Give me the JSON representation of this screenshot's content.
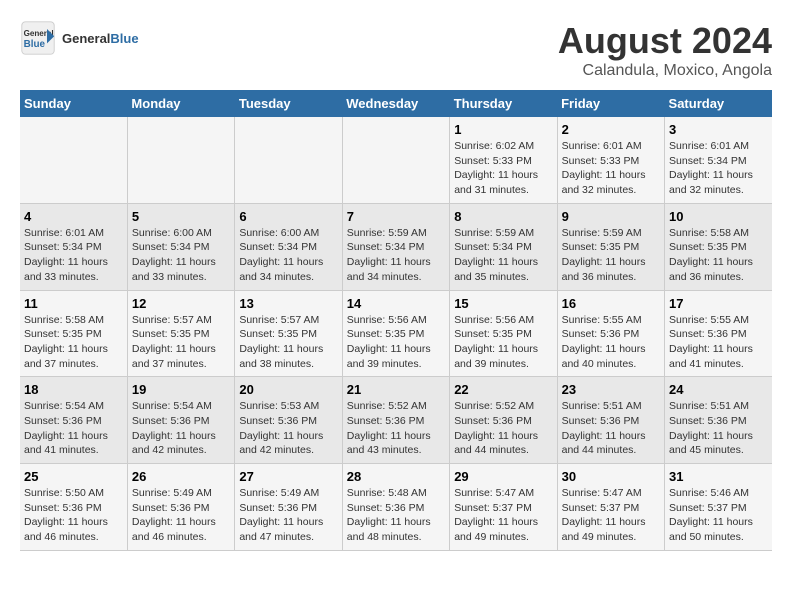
{
  "logo": {
    "name_part1": "General",
    "name_part2": "Blue"
  },
  "title": "August 2024",
  "subtitle": "Calandula, Moxico, Angola",
  "days_of_week": [
    "Sunday",
    "Monday",
    "Tuesday",
    "Wednesday",
    "Thursday",
    "Friday",
    "Saturday"
  ],
  "weeks": [
    [
      {
        "day": "",
        "info": ""
      },
      {
        "day": "",
        "info": ""
      },
      {
        "day": "",
        "info": ""
      },
      {
        "day": "",
        "info": ""
      },
      {
        "day": "1",
        "info": "Sunrise: 6:02 AM\nSunset: 5:33 PM\nDaylight: 11 hours and 31 minutes."
      },
      {
        "day": "2",
        "info": "Sunrise: 6:01 AM\nSunset: 5:33 PM\nDaylight: 11 hours and 32 minutes."
      },
      {
        "day": "3",
        "info": "Sunrise: 6:01 AM\nSunset: 5:34 PM\nDaylight: 11 hours and 32 minutes."
      }
    ],
    [
      {
        "day": "4",
        "info": "Sunrise: 6:01 AM\nSunset: 5:34 PM\nDaylight: 11 hours and 33 minutes."
      },
      {
        "day": "5",
        "info": "Sunrise: 6:00 AM\nSunset: 5:34 PM\nDaylight: 11 hours and 33 minutes."
      },
      {
        "day": "6",
        "info": "Sunrise: 6:00 AM\nSunset: 5:34 PM\nDaylight: 11 hours and 34 minutes."
      },
      {
        "day": "7",
        "info": "Sunrise: 5:59 AM\nSunset: 5:34 PM\nDaylight: 11 hours and 34 minutes."
      },
      {
        "day": "8",
        "info": "Sunrise: 5:59 AM\nSunset: 5:34 PM\nDaylight: 11 hours and 35 minutes."
      },
      {
        "day": "9",
        "info": "Sunrise: 5:59 AM\nSunset: 5:35 PM\nDaylight: 11 hours and 36 minutes."
      },
      {
        "day": "10",
        "info": "Sunrise: 5:58 AM\nSunset: 5:35 PM\nDaylight: 11 hours and 36 minutes."
      }
    ],
    [
      {
        "day": "11",
        "info": "Sunrise: 5:58 AM\nSunset: 5:35 PM\nDaylight: 11 hours and 37 minutes."
      },
      {
        "day": "12",
        "info": "Sunrise: 5:57 AM\nSunset: 5:35 PM\nDaylight: 11 hours and 37 minutes."
      },
      {
        "day": "13",
        "info": "Sunrise: 5:57 AM\nSunset: 5:35 PM\nDaylight: 11 hours and 38 minutes."
      },
      {
        "day": "14",
        "info": "Sunrise: 5:56 AM\nSunset: 5:35 PM\nDaylight: 11 hours and 39 minutes."
      },
      {
        "day": "15",
        "info": "Sunrise: 5:56 AM\nSunset: 5:35 PM\nDaylight: 11 hours and 39 minutes."
      },
      {
        "day": "16",
        "info": "Sunrise: 5:55 AM\nSunset: 5:36 PM\nDaylight: 11 hours and 40 minutes."
      },
      {
        "day": "17",
        "info": "Sunrise: 5:55 AM\nSunset: 5:36 PM\nDaylight: 11 hours and 41 minutes."
      }
    ],
    [
      {
        "day": "18",
        "info": "Sunrise: 5:54 AM\nSunset: 5:36 PM\nDaylight: 11 hours and 41 minutes."
      },
      {
        "day": "19",
        "info": "Sunrise: 5:54 AM\nSunset: 5:36 PM\nDaylight: 11 hours and 42 minutes."
      },
      {
        "day": "20",
        "info": "Sunrise: 5:53 AM\nSunset: 5:36 PM\nDaylight: 11 hours and 42 minutes."
      },
      {
        "day": "21",
        "info": "Sunrise: 5:52 AM\nSunset: 5:36 PM\nDaylight: 11 hours and 43 minutes."
      },
      {
        "day": "22",
        "info": "Sunrise: 5:52 AM\nSunset: 5:36 PM\nDaylight: 11 hours and 44 minutes."
      },
      {
        "day": "23",
        "info": "Sunrise: 5:51 AM\nSunset: 5:36 PM\nDaylight: 11 hours and 44 minutes."
      },
      {
        "day": "24",
        "info": "Sunrise: 5:51 AM\nSunset: 5:36 PM\nDaylight: 11 hours and 45 minutes."
      }
    ],
    [
      {
        "day": "25",
        "info": "Sunrise: 5:50 AM\nSunset: 5:36 PM\nDaylight: 11 hours and 46 minutes."
      },
      {
        "day": "26",
        "info": "Sunrise: 5:49 AM\nSunset: 5:36 PM\nDaylight: 11 hours and 46 minutes."
      },
      {
        "day": "27",
        "info": "Sunrise: 5:49 AM\nSunset: 5:36 PM\nDaylight: 11 hours and 47 minutes."
      },
      {
        "day": "28",
        "info": "Sunrise: 5:48 AM\nSunset: 5:36 PM\nDaylight: 11 hours and 48 minutes."
      },
      {
        "day": "29",
        "info": "Sunrise: 5:47 AM\nSunset: 5:37 PM\nDaylight: 11 hours and 49 minutes."
      },
      {
        "day": "30",
        "info": "Sunrise: 5:47 AM\nSunset: 5:37 PM\nDaylight: 11 hours and 49 minutes."
      },
      {
        "day": "31",
        "info": "Sunrise: 5:46 AM\nSunset: 5:37 PM\nDaylight: 11 hours and 50 minutes."
      }
    ]
  ]
}
